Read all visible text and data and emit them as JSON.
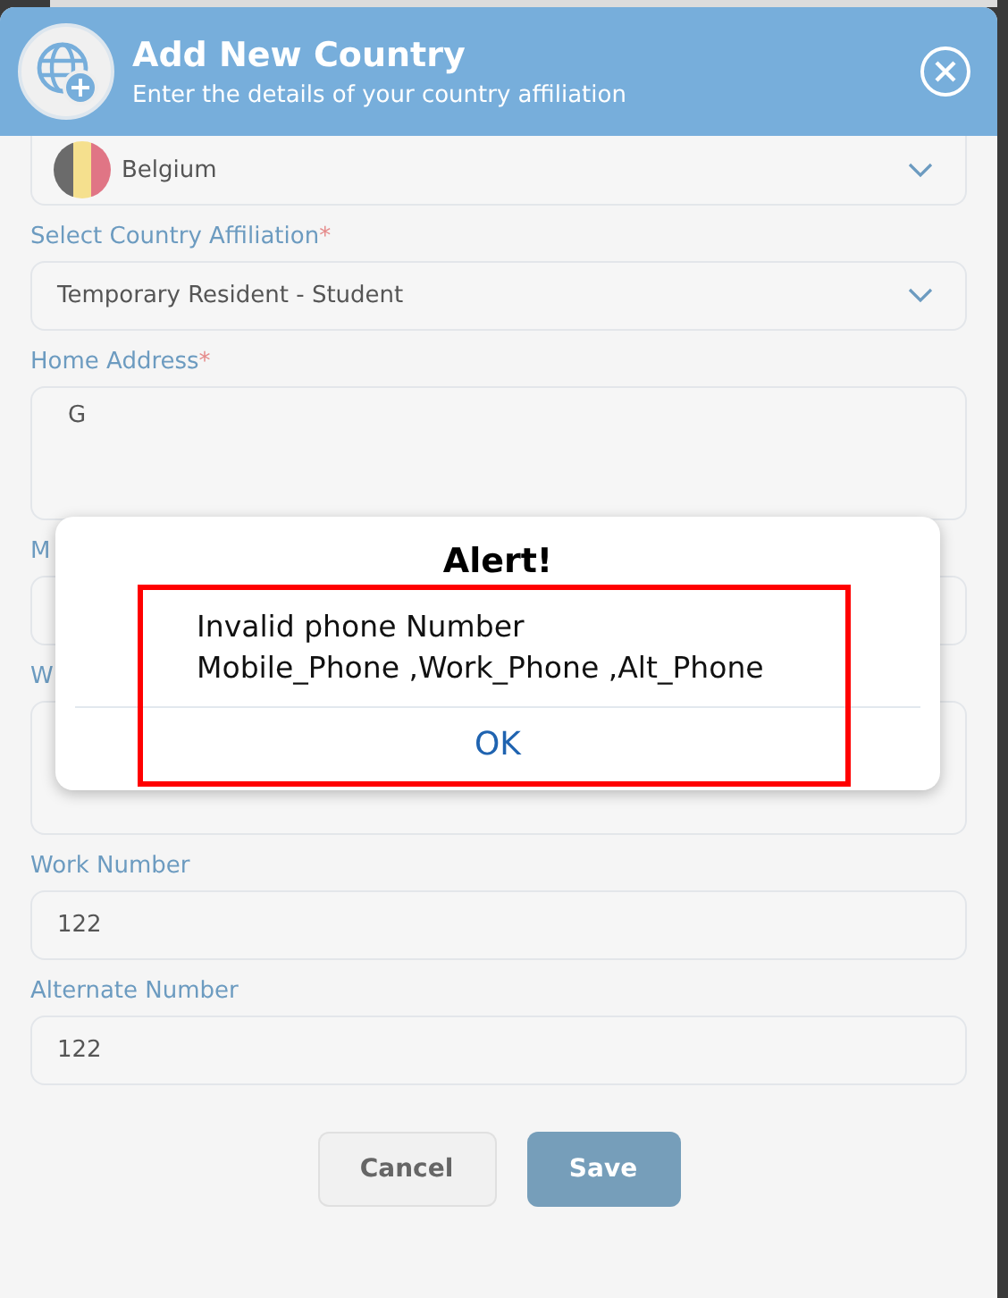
{
  "dialog": {
    "title": "Add New Country",
    "subtitle": "Enter the details of your country affiliation"
  },
  "fields": [
    {
      "kind": "country",
      "value": "Belgium"
    },
    {
      "kind": "select",
      "label": "Select Country Affiliation",
      "required_mark": "*",
      "value": "Temporary Resident - Student"
    },
    {
      "kind": "textarea",
      "label": "Home Address",
      "required_mark": "*",
      "value": "G"
    },
    {
      "kind": "input",
      "label": "M"
    },
    {
      "kind": "textarea",
      "label": "W"
    },
    {
      "kind": "input",
      "label": "Work Number",
      "value": "122"
    },
    {
      "kind": "input",
      "label": "Alternate Number",
      "value": "122"
    }
  ],
  "buttons": [
    {
      "label": "Cancel",
      "kind": "secondary"
    },
    {
      "label": "Save",
      "kind": "primary"
    }
  ],
  "alert": {
    "title": "Alert!",
    "message": [
      "Invalid phone Number",
      "Mobile_Phone ,Work_Phone ,Alt_Phone"
    ],
    "button": "OK"
  }
}
